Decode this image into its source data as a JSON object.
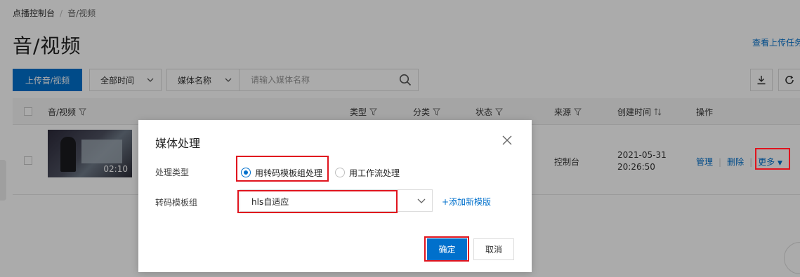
{
  "breadcrumb": {
    "root": "点播控制台",
    "separator": "/",
    "current": "音/视频"
  },
  "page": {
    "title": "音/视频",
    "view_tasks_link": "查看上传任务"
  },
  "toolbar": {
    "upload_button": "上传音/视频",
    "time_filter": "全部时间",
    "search_field_select": "媒体名称",
    "search_placeholder": "请输入媒体名称"
  },
  "table": {
    "columns": {
      "media": "音/视频",
      "type": "类型",
      "category": "分类",
      "status": "状态",
      "source": "来源",
      "created": "创建时间",
      "actions": "操作"
    },
    "rows": [
      {
        "duration": "02:10",
        "source": "控制台",
        "created_date": "2021-05-31",
        "created_time": "20:26:50",
        "action_manage": "管理",
        "action_delete": "删除",
        "action_more": "更多"
      }
    ]
  },
  "dialog": {
    "title": "媒体处理",
    "processing_type_label": "处理类型",
    "option_template": "用转码模板组处理",
    "option_workflow": "用工作流处理",
    "selected_option": "用转码模板组处理",
    "template_group_label": "转码模板组",
    "template_group_value": "hls自适应",
    "add_template_link": "+添加新模版",
    "confirm_button": "确定",
    "cancel_button": "取消"
  },
  "colors": {
    "accent": "#0070cc",
    "highlight": "#e0141e",
    "overlay": "rgba(0,0,0,0.33)"
  }
}
